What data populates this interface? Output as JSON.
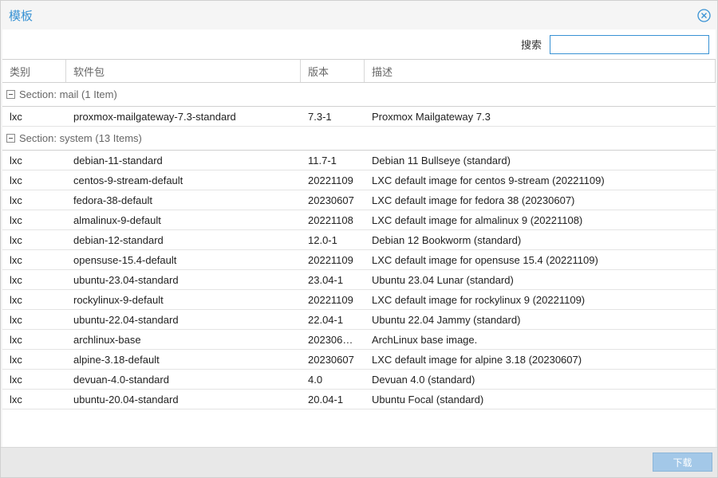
{
  "window": {
    "title": "模板"
  },
  "toolbar": {
    "search_label": "搜索",
    "search_value": ""
  },
  "columns": [
    "类别",
    "软件包",
    "版本",
    "描述"
  ],
  "groups": [
    {
      "label": "Section: mail (1 Item)",
      "rows": [
        [
          "lxc",
          "proxmox-mailgateway-7.3-standard",
          "7.3-1",
          "Proxmox Mailgateway 7.3"
        ]
      ]
    },
    {
      "label": "Section: system (13 Items)",
      "rows": [
        [
          "lxc",
          "debian-11-standard",
          "11.7-1",
          "Debian 11 Bullseye (standard)"
        ],
        [
          "lxc",
          "centos-9-stream-default",
          "20221109",
          "LXC default image for centos 9-stream (20221109)"
        ],
        [
          "lxc",
          "fedora-38-default",
          "20230607",
          "LXC default image for fedora 38 (20230607)"
        ],
        [
          "lxc",
          "almalinux-9-default",
          "20221108",
          "LXC default image for almalinux 9 (20221108)"
        ],
        [
          "lxc",
          "debian-12-standard",
          "12.0-1",
          "Debian 12 Bookworm (standard)"
        ],
        [
          "lxc",
          "opensuse-15.4-default",
          "20221109",
          "LXC default image for opensuse 15.4 (20221109)"
        ],
        [
          "lxc",
          "ubuntu-23.04-standard",
          "23.04-1",
          "Ubuntu 23.04 Lunar (standard)"
        ],
        [
          "lxc",
          "rockylinux-9-default",
          "20221109",
          "LXC default image for rockylinux 9 (20221109)"
        ],
        [
          "lxc",
          "ubuntu-22.04-standard",
          "22.04-1",
          "Ubuntu 22.04 Jammy (standard)"
        ],
        [
          "lxc",
          "archlinux-base",
          "202306…",
          "ArchLinux base image."
        ],
        [
          "lxc",
          "alpine-3.18-default",
          "20230607",
          "LXC default image for alpine 3.18 (20230607)"
        ],
        [
          "lxc",
          "devuan-4.0-standard",
          "4.0",
          "Devuan 4.0 (standard)"
        ],
        [
          "lxc",
          "ubuntu-20.04-standard",
          "20.04-1",
          "Ubuntu Focal (standard)"
        ]
      ]
    }
  ],
  "footer": {
    "download_label": "下载"
  },
  "colors": {
    "accent": "#3892d4",
    "button_disabled": "#a3c8e8"
  }
}
